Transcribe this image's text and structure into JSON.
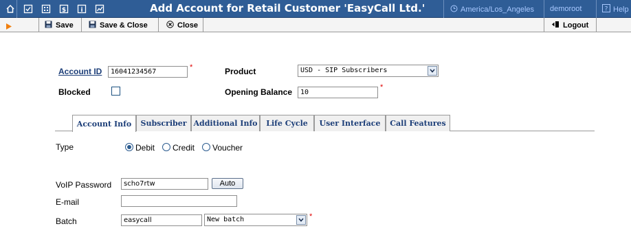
{
  "header": {
    "title": "Add Account for Retail Customer 'EasyCall Ltd.'",
    "timezone": "America/Los_Angeles",
    "user": "demoroot",
    "help": "Help"
  },
  "toolbar": {
    "save": "Save",
    "save_close": "Save & Close",
    "close": "Close",
    "logout": "Logout"
  },
  "form": {
    "account_id_label": "Account ID",
    "account_id_value": "16041234567",
    "product_label": "Product",
    "product_value": "USD - SIP Subscribers",
    "blocked_label": "Blocked",
    "blocked_checked": false,
    "opening_balance_label": "Opening Balance",
    "opening_balance_value": "10"
  },
  "tabs": [
    {
      "label": "Account Info",
      "active": true
    },
    {
      "label": "Subscriber",
      "active": false
    },
    {
      "label": "Additional Info",
      "active": false
    },
    {
      "label": "Life Cycle",
      "active": false
    },
    {
      "label": "User Interface",
      "active": false
    },
    {
      "label": "Call Features",
      "active": false
    }
  ],
  "account_info": {
    "type_label": "Type",
    "type_options": [
      "Debit",
      "Credit",
      "Voucher"
    ],
    "type_selected": "Debit",
    "voip_password_label": "VoIP Password",
    "voip_password_value": "scho7rtw",
    "auto_button": "Auto",
    "email_label": "E-mail",
    "email_value": "",
    "batch_label": "Batch",
    "batch_value": "easycall",
    "batch_select": "New batch"
  },
  "colors": {
    "titlebar": "#2f5d96",
    "tab_text": "#1c3e78",
    "required": "#e00000"
  }
}
